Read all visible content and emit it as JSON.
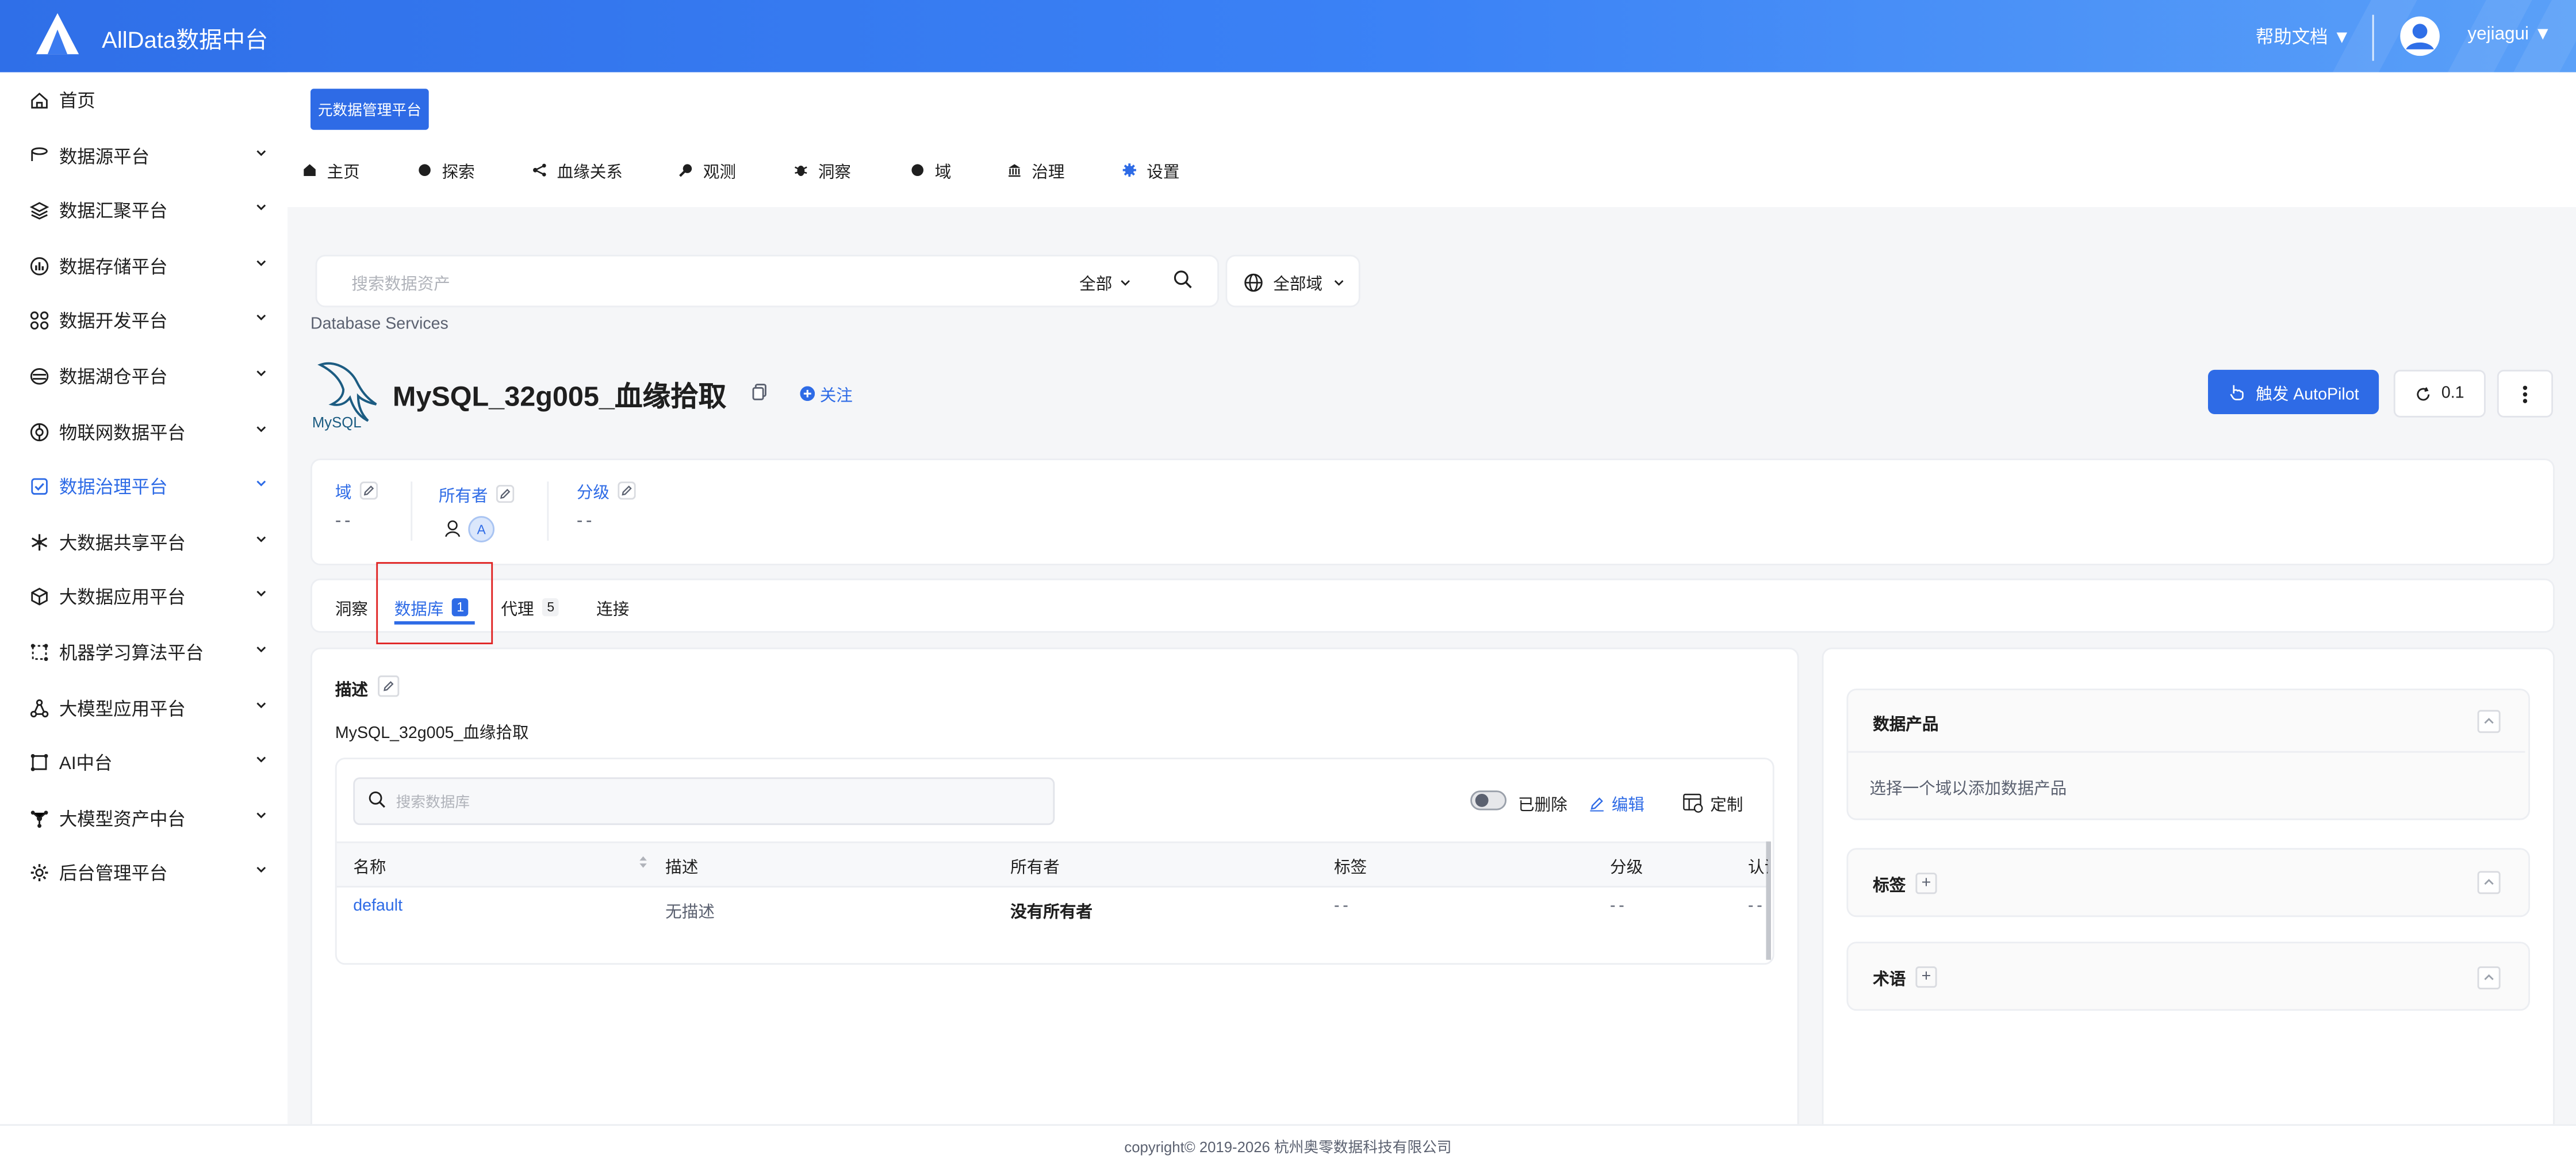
{
  "brand": {
    "name": "AllData数据中台"
  },
  "header": {
    "help": "帮助文档 ▼",
    "user": "yejiagui ▼"
  },
  "sidebar": {
    "items": [
      {
        "label": "首页",
        "icon": "home-icon"
      },
      {
        "label": "数据源平台",
        "icon": "database-icon"
      },
      {
        "label": "数据汇聚平台",
        "icon": "layers-icon"
      },
      {
        "label": "数据存储平台",
        "icon": "chart-icon"
      },
      {
        "label": "数据开发平台",
        "icon": "grid-icon"
      },
      {
        "label": "数据湖仓平台",
        "icon": "lake-icon"
      },
      {
        "label": "物联网数据平台",
        "icon": "iot-icon"
      },
      {
        "label": "数据治理平台",
        "icon": "governance-icon",
        "active": true
      },
      {
        "label": "大数据共享平台",
        "icon": "share-icon"
      },
      {
        "label": "大数据应用平台",
        "icon": "cube-icon"
      },
      {
        "label": "机器学习算法平台",
        "icon": "ml-icon"
      },
      {
        "label": "大模型应用平台",
        "icon": "model-icon"
      },
      {
        "label": "AI中台",
        "icon": "ai-icon"
      },
      {
        "label": "大模型资产中台",
        "icon": "asset-icon"
      },
      {
        "label": "后台管理平台",
        "icon": "settings-icon"
      }
    ]
  },
  "top": {
    "platform_button": "元数据管理平台"
  },
  "nav": {
    "items": [
      {
        "label": "主页"
      },
      {
        "label": "探索"
      },
      {
        "label": "血缘关系"
      },
      {
        "label": "观测"
      },
      {
        "label": "洞察"
      },
      {
        "label": "域"
      },
      {
        "label": "治理"
      },
      {
        "label": "设置"
      }
    ]
  },
  "search": {
    "placeholder": "搜索数据资产",
    "scope": "全部",
    "domain": "全部域"
  },
  "breadcrumb": "Database Services",
  "service": {
    "title": "MySQL_32g005_血缘拾取",
    "follow": "关注",
    "logo_text": "MySQL"
  },
  "actions": {
    "autopilot": "触发 AutoPilot",
    "version": "0.1"
  },
  "meta": {
    "domain": {
      "label": "域",
      "value": "--"
    },
    "owner": {
      "label": "所有者",
      "avatar": "A"
    },
    "tier": {
      "label": "分级",
      "value": "--"
    }
  },
  "tabs": [
    {
      "label": "洞察",
      "count": ""
    },
    {
      "label": "数据库",
      "count": "1"
    },
    {
      "label": "代理",
      "count": "5"
    },
    {
      "label": "连接",
      "count": ""
    }
  ],
  "description": {
    "label": "描述",
    "text": "MySQL_32g005_血缘拾取"
  },
  "db_table": {
    "search_placeholder": "搜索数据库",
    "deleted_label": "已删除",
    "edit_label": "编辑",
    "custom_label": "定制",
    "columns": [
      "名称",
      "描述",
      "所有者",
      "标签",
      "分级",
      "认证"
    ],
    "rows": [
      {
        "name": "default",
        "desc": "无描述",
        "owner": "没有所有者",
        "tags": "--",
        "tier": "--",
        "cert": "--"
      }
    ]
  },
  "right_panel": {
    "data_product": {
      "title": "数据产品",
      "hint": "选择一个域以添加数据产品"
    },
    "tags": {
      "title": "标签"
    },
    "glossary": {
      "title": "术语"
    }
  },
  "footer": {
    "copyright": "copyright© 2019-2026 杭州奥零数据科技有限公司"
  }
}
